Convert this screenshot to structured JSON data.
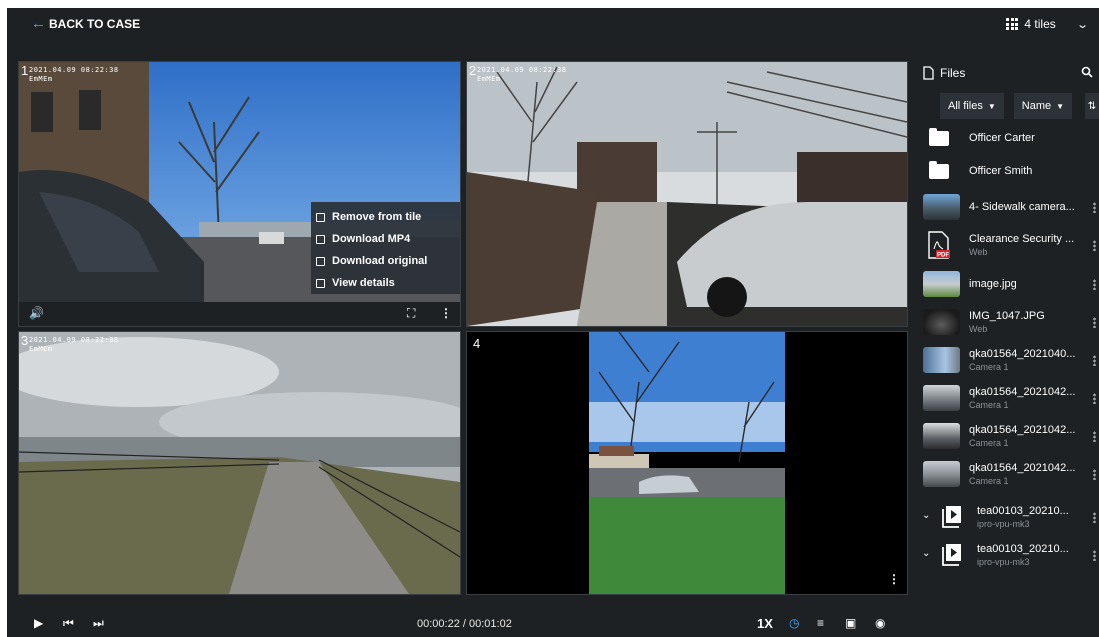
{
  "header": {
    "back_label": "BACK TO CASE",
    "tiles_label": "4 tiles"
  },
  "tiles": [
    {
      "num": "1",
      "osd": [
        "2021.04.09 08:22:38",
        "EmMEm"
      ]
    },
    {
      "num": "2",
      "osd": [
        "2021.04.09 08:22:38",
        "EmMEm"
      ]
    },
    {
      "num": "3",
      "osd": [
        "2021.04.09 08:22:38",
        "EmMEm"
      ]
    },
    {
      "num": "4"
    }
  ],
  "context_menu": {
    "items": [
      "Remove from tile",
      "Download MP4",
      "Download original",
      "View details"
    ]
  },
  "playback": {
    "timecode": "00:00:22 / 00:01:02",
    "speed": "1X"
  },
  "files_panel": {
    "title": "Files",
    "filter_label": "All files",
    "sort_label": "Name",
    "items": [
      {
        "name": "Officer Carter",
        "sub": "",
        "kind": "folder"
      },
      {
        "name": "Officer Smith",
        "sub": "",
        "kind": "folder"
      },
      {
        "name": "4- Sidewalk camera...",
        "sub": "",
        "kind": "video"
      },
      {
        "name": "Clearance Security ...",
        "sub": "Web",
        "kind": "pdf"
      },
      {
        "name": "image.jpg",
        "sub": "",
        "kind": "image"
      },
      {
        "name": "IMG_1047.JPG",
        "sub": "Web",
        "kind": "image"
      },
      {
        "name": "qka01564_2021040...",
        "sub": "Camera 1",
        "kind": "video"
      },
      {
        "name": "qka01564_2021042...",
        "sub": "Camera 1",
        "kind": "video"
      },
      {
        "name": "qka01564_2021042...",
        "sub": "Camera 1",
        "kind": "video"
      },
      {
        "name": "qka01564_2021042...",
        "sub": "Camera 1",
        "kind": "video"
      },
      {
        "name": "tea00103_20210...",
        "sub": "ipro-vpu-mk3",
        "kind": "group"
      },
      {
        "name": "tea00103_20210...",
        "sub": "ipro-vpu-mk3",
        "kind": "group"
      }
    ]
  },
  "colors": {
    "accent": "#4aa8ff",
    "panel": "#1d2124",
    "button": "#2c3237"
  }
}
